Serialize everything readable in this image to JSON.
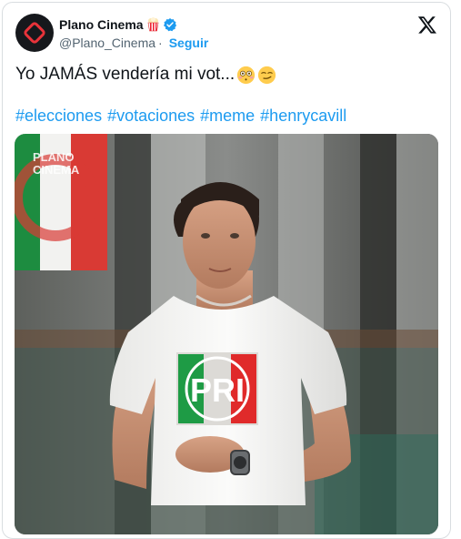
{
  "tweet": {
    "display_name": "Plano Cinema",
    "handle": "@Plano_Cinema",
    "separator": "·",
    "follow_label": "Seguir",
    "text": "Yo JAMÁS vendería mi vot...",
    "hashtags": [
      "#elecciones",
      "#votaciones",
      "#meme",
      "#henrycavill"
    ],
    "emojis": [
      "flushed-face-emoji",
      "smirking-face-emoji"
    ]
  },
  "media": {
    "watermark_line1": "PLANO",
    "watermark_line2": "CINEMA",
    "shirt_logo": "PRI"
  },
  "colors": {
    "link": "#1d9bf0",
    "verified": "#1d9bf0",
    "pri_green": "#1e9b45",
    "pri_red": "#e02a2a"
  }
}
